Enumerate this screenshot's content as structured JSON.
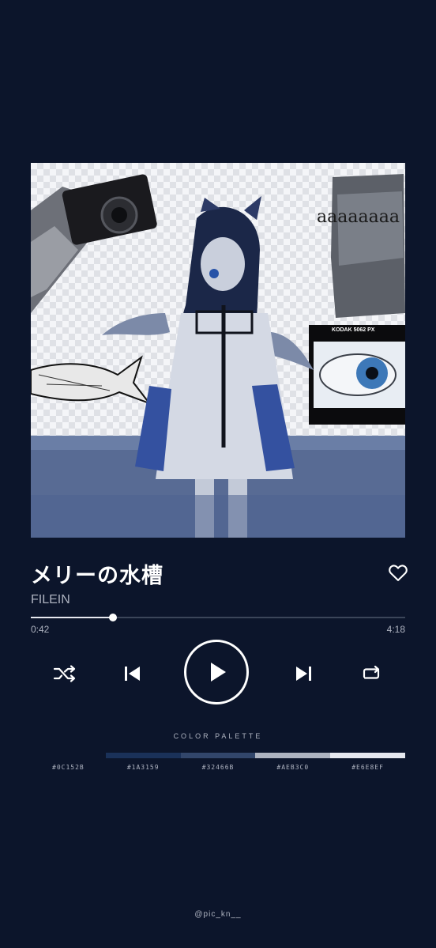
{
  "album": {
    "art_text": "aaaaaaaa",
    "film_label": "KODAK 5062 PX"
  },
  "track": {
    "title": "メリーの水槽",
    "artist": "FILEIN",
    "current_time": "0:42",
    "total_time": "4:18",
    "progress": 0.22
  },
  "icons": {
    "favorite": "heart-icon",
    "shuffle": "shuffle-icon",
    "previous": "skip-previous-icon",
    "play": "play-icon",
    "next": "skip-next-icon",
    "repeat": "repeat-icon"
  },
  "palette": {
    "title": "COLOR PALETTE",
    "colors": [
      {
        "hex": "#0C152B",
        "label": "#0C152B"
      },
      {
        "hex": "#1A3159",
        "label": "#1A3159"
      },
      {
        "hex": "#32466B",
        "label": "#32466B"
      },
      {
        "hex": "#AEB3C0",
        "label": "#AEB3C0"
      },
      {
        "hex": "#E6E8EF",
        "label": "#E6E8EF"
      }
    ]
  },
  "credit": "@pic_kn__"
}
